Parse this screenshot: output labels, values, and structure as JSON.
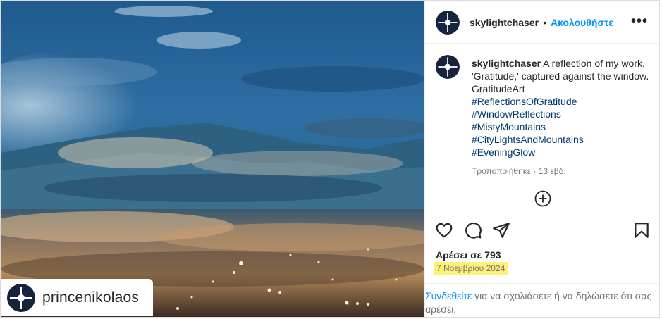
{
  "post": {
    "author": "skylightchaser",
    "separator": "•",
    "follow_label": "Ακολουθήστε",
    "more_icon": "more-horizontal-icon",
    "caption_text": " A reflection of my work, 'Gratitude,' captured against the window. GratitudeArt",
    "hashtags": [
      "#ReflectionsOfGratitude",
      "#WindowReflections",
      "#MistyMountains",
      "#CityLightsAndMountains",
      "#EveningGlow"
    ],
    "edited_label": "Τροποποιήθηκε · 13 εβδ.",
    "likes_label": "Αρέσει σε 793",
    "date_label": "7 Νοεμβρίου 2024",
    "comment_prompt": {
      "login_link": "Συνδεθείτε",
      "rest": " για να σχολιάσετε ή να δηλώσετε ότι σας αρέσει."
    }
  },
  "image_overlay": {
    "repost_username": "princenikolaos"
  },
  "colors": {
    "link_blue": "#0095f6",
    "hashtag_blue": "#00376b",
    "date_highlight": "#fff176",
    "border": "#dbdbdb"
  },
  "icons": [
    "heart-icon",
    "comment-icon",
    "share-icon",
    "bookmark-icon",
    "plus-circle-icon"
  ]
}
